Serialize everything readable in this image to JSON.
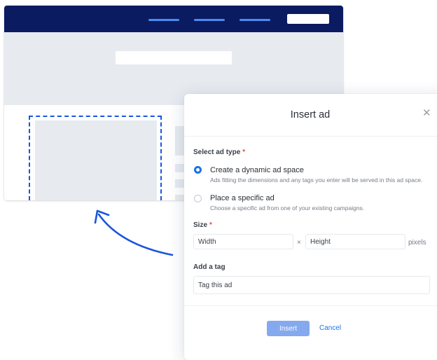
{
  "modal": {
    "title": "Insert ad",
    "close_icon": "close-icon",
    "ad_type": {
      "label": "Select ad type",
      "required_mark": "*",
      "options": [
        {
          "title": "Create a dynamic ad space",
          "description": "Ads fitting the dimensions and any tags you enter will be served in this ad space.",
          "selected": true
        },
        {
          "title": "Place a specific ad",
          "description": "Choose a specific ad from one of your existing campaigns.",
          "selected": false
        }
      ]
    },
    "size": {
      "label": "Size",
      "required_mark": "*",
      "width_placeholder": "Width",
      "separator": "×",
      "height_placeholder": "Height",
      "unit": "pixels"
    },
    "tag": {
      "label": "Add a tag",
      "placeholder": "Tag this ad"
    },
    "actions": {
      "insert_label": "Insert",
      "cancel_label": "Cancel"
    }
  },
  "colors": {
    "nav_background": "#0b1b61",
    "accent": "#1a73e8",
    "placeholder_gray": "#e7ebf0",
    "insert_button": "#84a9ee",
    "required": "#e34848"
  }
}
